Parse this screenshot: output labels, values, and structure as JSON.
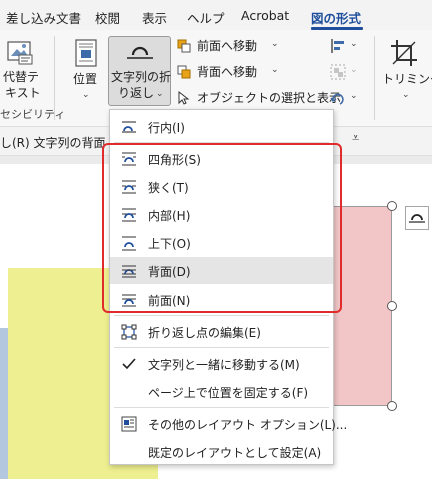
{
  "tabs": [
    {
      "label": "差し込み文書"
    },
    {
      "label": "校閲"
    },
    {
      "label": "表示"
    },
    {
      "label": "ヘルプ"
    },
    {
      "label": "Acrobat"
    },
    {
      "label": "図の形式",
      "active": true
    }
  ],
  "ribbon": {
    "alt_text_line1": "代替テ",
    "alt_text_line2": "キスト",
    "accessibility_label": "セシビリティ",
    "position_label": "位置",
    "wrap_text_line1": "文字列の折",
    "wrap_text_line2": "り返し",
    "bring_forward": "前面へ移動",
    "send_backward": "背面へ移動",
    "selection_pane": "オブジェクトの選択と表示",
    "trim_label": "トリミング"
  },
  "formula_bar": {
    "text": "し(R) 文字列の背面"
  },
  "wrap_menu": {
    "items": [
      {
        "label": "行内(I)",
        "icon": "inline-with-text-icon"
      },
      {
        "label": "四角形(S)",
        "icon": "square-wrap-icon"
      },
      {
        "label": "狭く(T)",
        "icon": "tight-wrap-icon"
      },
      {
        "label": "内部(H)",
        "icon": "through-wrap-icon"
      },
      {
        "label": "上下(O)",
        "icon": "top-bottom-wrap-icon"
      },
      {
        "label": "背面(D)",
        "icon": "behind-text-icon",
        "highlighted": true
      },
      {
        "label": "前面(N)",
        "icon": "in-front-of-text-icon"
      },
      {
        "label": "折り返し点の編集(E)",
        "icon": "edit-wrap-points-icon"
      },
      {
        "label": "文字列と一緒に移動する(M)",
        "icon": "check-icon",
        "checked": true
      },
      {
        "label": "ページ上で位置を固定する(F)",
        "icon": ""
      },
      {
        "label": "その他のレイアウト オプション(L)...",
        "icon": "more-layout-options-icon"
      },
      {
        "label": "既定のレイアウトとして設定(A)",
        "icon": ""
      }
    ]
  },
  "colors": {
    "accent": "#1e4e9c",
    "highlight_box": "#e12b2b",
    "shape_yellow": "#eeef90",
    "shape_blue": "#b3c8df",
    "shape_pink": "#f2c6c7"
  }
}
